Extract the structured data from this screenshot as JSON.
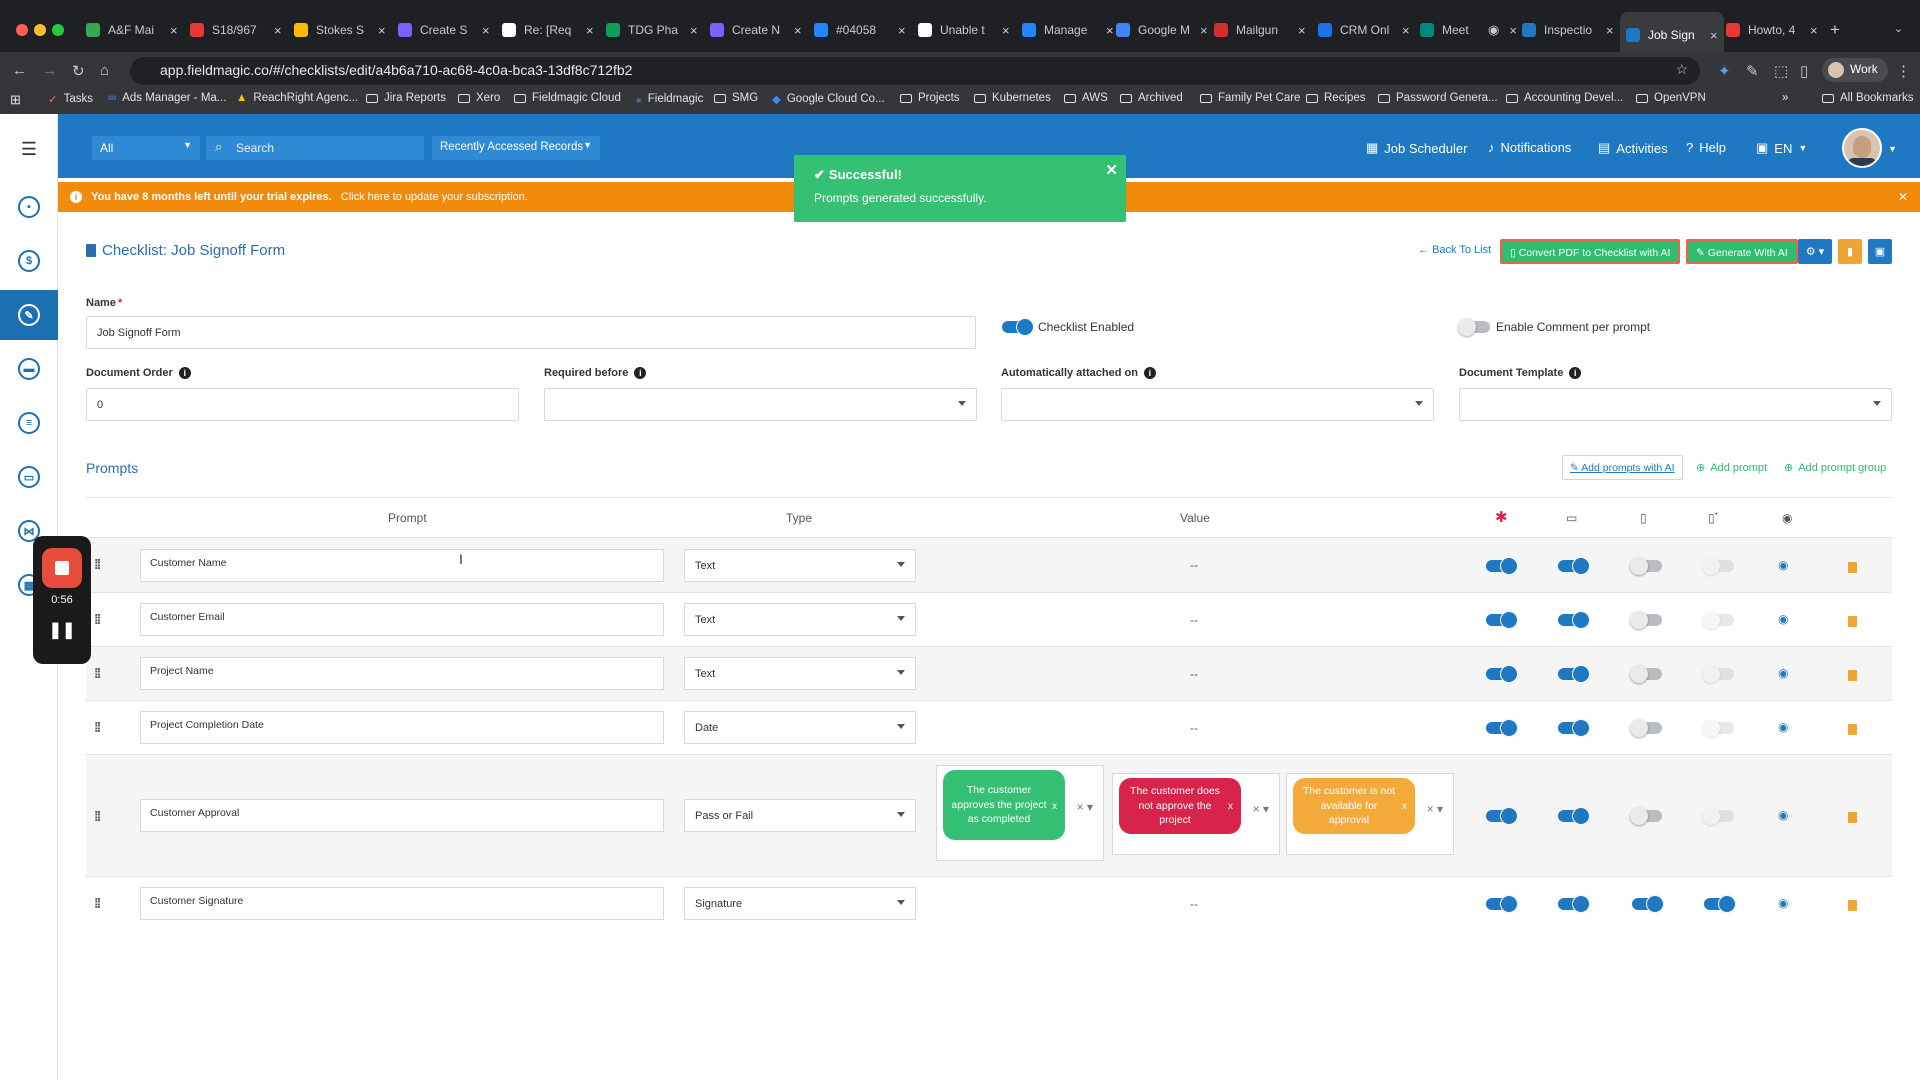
{
  "browser": {
    "tabs": [
      "A&F Mai",
      "S18/967",
      "Stokes S",
      "Create S",
      "Re: [Req",
      "TDG Pha",
      "Create N",
      "#04058",
      "Unable t",
      "Manage",
      "Google M",
      "Mailgun",
      "CRM Onl",
      "Meet",
      "Inspectio",
      "Job Sign",
      "Howto, 4"
    ],
    "url": "app.fieldmagic.co/#/checklists/edit/a4b6a710-ac68-4c0a-bca3-13df8c712fb2",
    "profile": "Work",
    "bookmarks": [
      "Tasks",
      "Ads Manager - Ma...",
      "ReachRight Agenc...",
      "Jira Reports",
      "Xero",
      "Fieldmagic Cloud",
      "Fieldmagic",
      "SMG",
      "Google Cloud Co...",
      "Projects",
      "Kubernetes",
      "AWS",
      "Archived",
      "Family Pet Care",
      "Recipes",
      "Password Genera...",
      "Accounting Devel...",
      "OpenVPN"
    ],
    "all_bookmarks": "All Bookmarks",
    "more": "»"
  },
  "topnav": {
    "filter": "All",
    "search_placeholder": "Search",
    "recent": "Recently Accessed Records",
    "job_scheduler": "Job Scheduler",
    "notifications": "Notifications",
    "activities": "Activities",
    "help": "Help",
    "language": "EN"
  },
  "trial": {
    "warning": "You have 8 months left until your trial expires.",
    "link": "Click here to update your subscription."
  },
  "toast": {
    "title": "Successful!",
    "message": "Prompts generated successfully."
  },
  "header": {
    "title": "Checklist: Job Signoff Form",
    "back": "Back To List",
    "convert_pdf": "Convert PDF to Checklist with AI",
    "generate_ai": "Generate With AI"
  },
  "form": {
    "name_label": "Name",
    "name_value": "Job Signoff Form",
    "checklist_enabled": "Checklist Enabled",
    "enable_comment": "Enable Comment per prompt",
    "doc_order_label": "Document Order",
    "doc_order_value": "0",
    "required_before_label": "Required before",
    "auto_attached_label": "Automatically attached on",
    "doc_template_label": "Document Template"
  },
  "prompts": {
    "heading": "Prompts",
    "add_ai": "Add prompts with AI",
    "add_prompt": "Add prompt",
    "add_group": "Add prompt group",
    "columns": {
      "prompt": "Prompt",
      "type": "Type",
      "value": "Value"
    },
    "rows": [
      {
        "name": "Customer Name",
        "type": "Text",
        "value": "--",
        "toggles": [
          true,
          true,
          false,
          false
        ]
      },
      {
        "name": "Customer Email",
        "type": "Text",
        "value": "--",
        "toggles": [
          true,
          true,
          false,
          false
        ]
      },
      {
        "name": "Project Name",
        "type": "Text",
        "value": "--",
        "toggles": [
          true,
          true,
          false,
          false
        ]
      },
      {
        "name": "Project Completion Date",
        "type": "Date",
        "value": "--",
        "toggles": [
          true,
          true,
          false,
          false
        ]
      },
      {
        "name": "Customer Approval",
        "type": "Pass or Fail",
        "value": "",
        "toggles": [
          true,
          true,
          false,
          false
        ]
      },
      {
        "name": "Customer Signature",
        "type": "Signature",
        "value": "--",
        "toggles": [
          true,
          true,
          true,
          true
        ]
      }
    ],
    "approval_options": [
      {
        "label": "The customer approves the project as completed",
        "color": "#35c073"
      },
      {
        "label": "The customer does not approve the project",
        "color": "#d8234a"
      },
      {
        "label": "The customer is not available for approval",
        "color": "#f4a93b"
      }
    ],
    "remove_mark": "x"
  },
  "recorder": {
    "time": "0:56"
  },
  "colors": {
    "brand": "#1e78c2",
    "success": "#35c073",
    "warning": "#f28b0c",
    "danger": "#d8234a"
  }
}
